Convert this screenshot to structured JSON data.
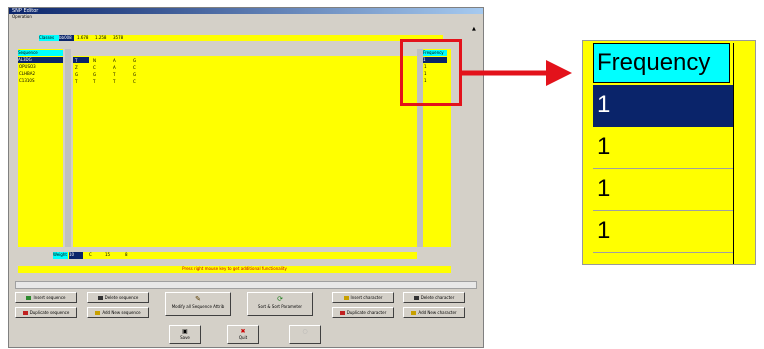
{
  "window": {
    "title": "SNP Editor",
    "menu": "Operation"
  },
  "top_track": {
    "cells": [
      "Classes",
      "bb008",
      "1.678",
      "1.258",
      "3578"
    ]
  },
  "sequences": {
    "header": "Sequence",
    "items": [
      "AL3DG",
      "OPUSO3",
      "CLHBA2",
      "C1310S"
    ]
  },
  "grid": {
    "rows": [
      [
        "T",
        "N",
        "A",
        "G"
      ],
      [
        "Z",
        "C",
        "A",
        "C"
      ],
      [
        "G",
        "G",
        "T",
        "G"
      ],
      [
        "T",
        "T",
        "T",
        "C"
      ]
    ]
  },
  "frequency": {
    "header": "Frequency",
    "values": [
      "1",
      "1",
      "1",
      "1"
    ]
  },
  "bottom_track": {
    "cells": [
      "Weight",
      "10",
      "C",
      "15",
      "8"
    ]
  },
  "hint": "Press right mouse key to get additional functionality",
  "buttons": {
    "insert_sequence": "Insert sequence",
    "delete_sequence": "Delete sequence",
    "duplicate_sequence": "Duplicate sequence",
    "add_new_sequence": "Add New sequence",
    "modify_all": "Modify all Sequence Attrib",
    "sort_by": "Sort & Sort Parameter",
    "insert_character": "Insert character",
    "delete_character": "Delete character",
    "duplicate_character": "Duplicate character",
    "add_new_character": "Add New character",
    "save": "Save",
    "quit": "Quit",
    "disabled": ""
  },
  "zoom": {
    "header": "Frequency",
    "values": [
      "1",
      "1",
      "1",
      "1"
    ]
  },
  "colors": {
    "highlight": "#0a246a",
    "grid": "#ffff00",
    "header": "#00ffff",
    "callout": "#e3121b"
  }
}
